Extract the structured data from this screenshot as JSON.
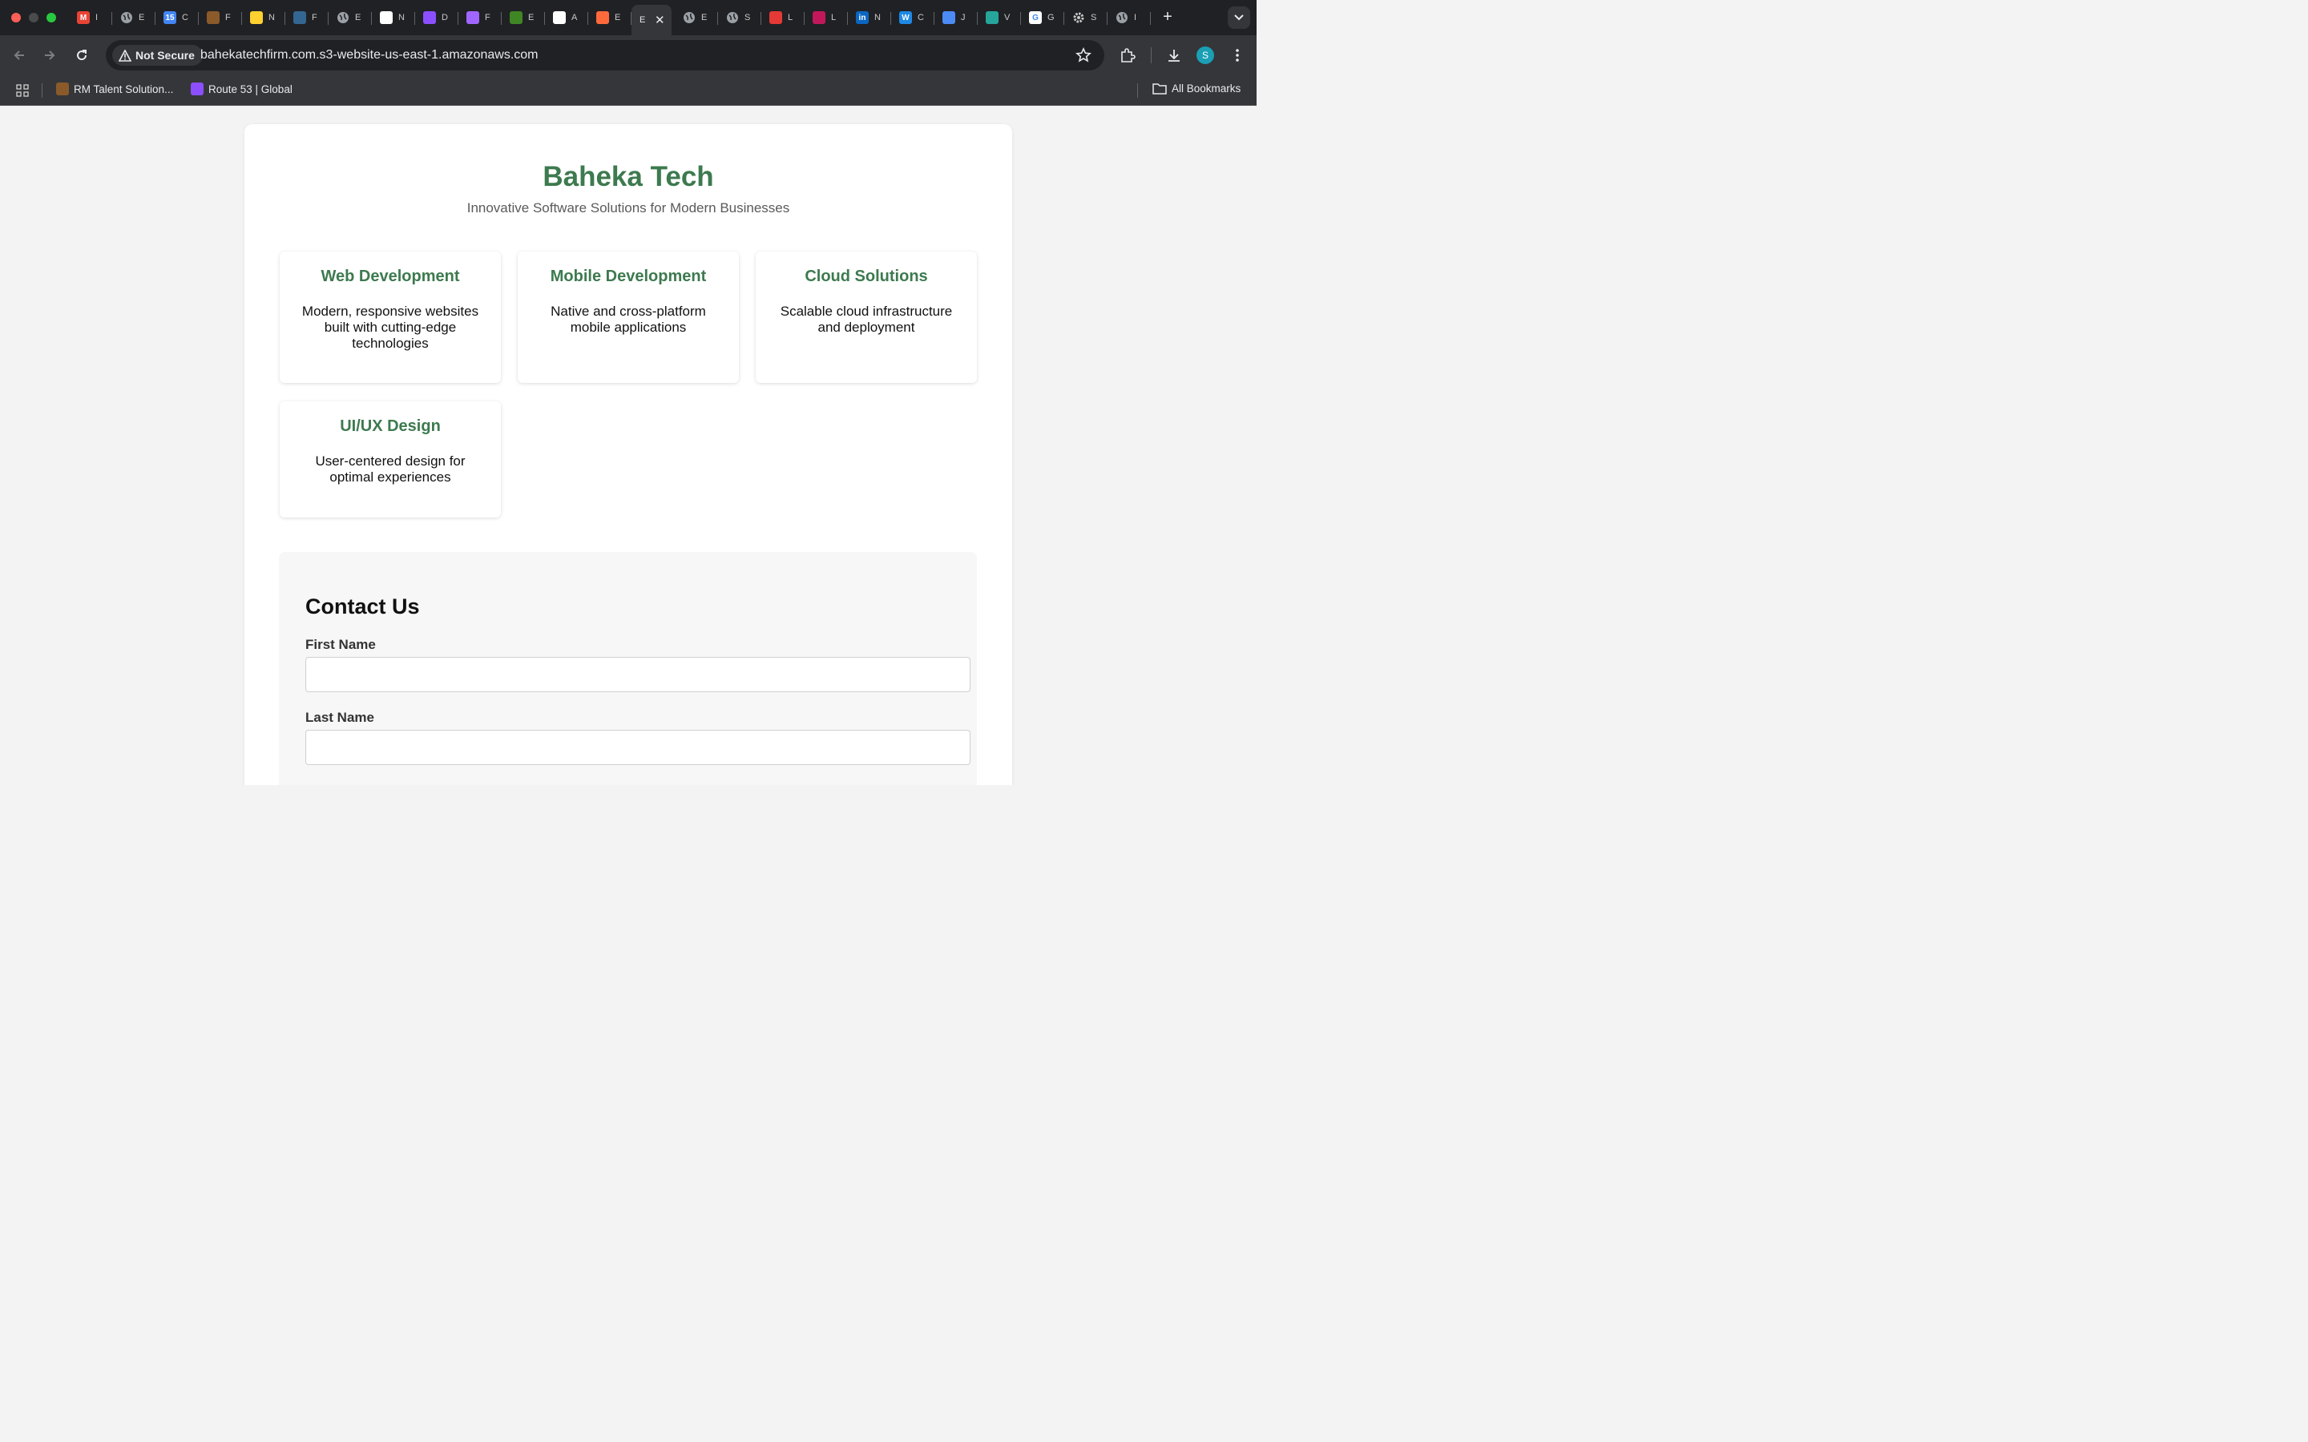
{
  "browser": {
    "tabs": [
      {
        "icon": "gmail-icon",
        "title": "I",
        "color": "#ea4335",
        "glyph": "M"
      },
      {
        "icon": "globe-icon",
        "title": "E",
        "color": "#9aa0a6",
        "glyph": ""
      },
      {
        "icon": "calendar-icon",
        "title": "C",
        "color": "#4285f4",
        "glyph": "15"
      },
      {
        "icon": "tab-app-icon",
        "title": "F",
        "color": "#8b5a2b",
        "glyph": ""
      },
      {
        "icon": "miro-icon",
        "title": "N",
        "color": "#ffd02f",
        "glyph": ""
      },
      {
        "icon": "postgres-icon",
        "title": "F",
        "color": "#336791",
        "glyph": ""
      },
      {
        "icon": "globe-icon",
        "title": "E",
        "color": "#9aa0a6",
        "glyph": ""
      },
      {
        "icon": "link-icon",
        "title": "N",
        "color": "#ffffff",
        "glyph": ""
      },
      {
        "icon": "route53-icon",
        "title": "D",
        "color": "#8c4fff",
        "glyph": ""
      },
      {
        "icon": "cube-icon",
        "title": "F",
        "color": "#a166ff",
        "glyph": ""
      },
      {
        "icon": "aws-green-icon",
        "title": "E",
        "color": "#3f8624",
        "glyph": ""
      },
      {
        "icon": "openai-icon",
        "title": "A",
        "color": "#ffffff",
        "glyph": ""
      },
      {
        "icon": "orange-app-icon",
        "title": "E",
        "color": "#ff6a3d",
        "glyph": ""
      },
      {
        "icon": "",
        "title": "E",
        "color": "",
        "glyph": "",
        "active": true
      },
      {
        "icon": "globe-icon",
        "title": "E",
        "color": "#9aa0a6",
        "glyph": ""
      },
      {
        "icon": "globe-icon",
        "title": "S",
        "color": "#9aa0a6",
        "glyph": ""
      },
      {
        "icon": "red-app-icon",
        "title": "L",
        "color": "#e53935",
        "glyph": ""
      },
      {
        "icon": "eye-icon",
        "title": "L",
        "color": "#c2185b",
        "glyph": ""
      },
      {
        "icon": "linkedin-icon",
        "title": "N",
        "color": "#0a66c2",
        "glyph": "in"
      },
      {
        "icon": "w-app-icon",
        "title": "C",
        "color": "#1e88e5",
        "glyph": "W"
      },
      {
        "icon": "grid-app-icon",
        "title": "J",
        "color": "#4c8bf5",
        "glyph": ""
      },
      {
        "icon": "leaf-icon",
        "title": "V",
        "color": "#26a69a",
        "glyph": ""
      },
      {
        "icon": "google-icon",
        "title": "G",
        "color": "#ffffff",
        "glyph": "G"
      },
      {
        "icon": "gear-icon",
        "title": "S",
        "color": "#9aa0a6",
        "glyph": ""
      },
      {
        "icon": "globe-icon",
        "title": "I",
        "color": "#9aa0a6",
        "glyph": ""
      }
    ],
    "security_label": "Not Secure",
    "url": "bahekatechfirm.com.s3-website-us-east-1.amazonaws.com",
    "profile_initial": "S",
    "bookmarks": [
      {
        "label": "RM Talent Solution...",
        "color": "#8b5a2b"
      },
      {
        "label": "Route 53 | Global",
        "color": "#8c4fff"
      }
    ],
    "all_bookmarks_label": "All Bookmarks"
  },
  "page": {
    "title": "Baheka Tech",
    "tagline": "Innovative Software Solutions for Modern Businesses",
    "services": [
      {
        "title": "Web Development",
        "description": "Modern, responsive websites built with cutting-edge technologies"
      },
      {
        "title": "Mobile Development",
        "description": "Native and cross-platform mobile applications"
      },
      {
        "title": "Cloud Solutions",
        "description": "Scalable cloud infrastructure and deployment"
      },
      {
        "title": "UI/UX Design",
        "description": "User-centered design for optimal experiences"
      }
    ],
    "contact": {
      "heading": "Contact Us",
      "first_name_label": "First Name",
      "first_name_value": "",
      "last_name_label": "Last Name",
      "last_name_value": ""
    }
  },
  "colors": {
    "brand_green": "#3d7a4f",
    "chrome_dark": "#202124",
    "chrome_toolbar": "#35363a"
  }
}
